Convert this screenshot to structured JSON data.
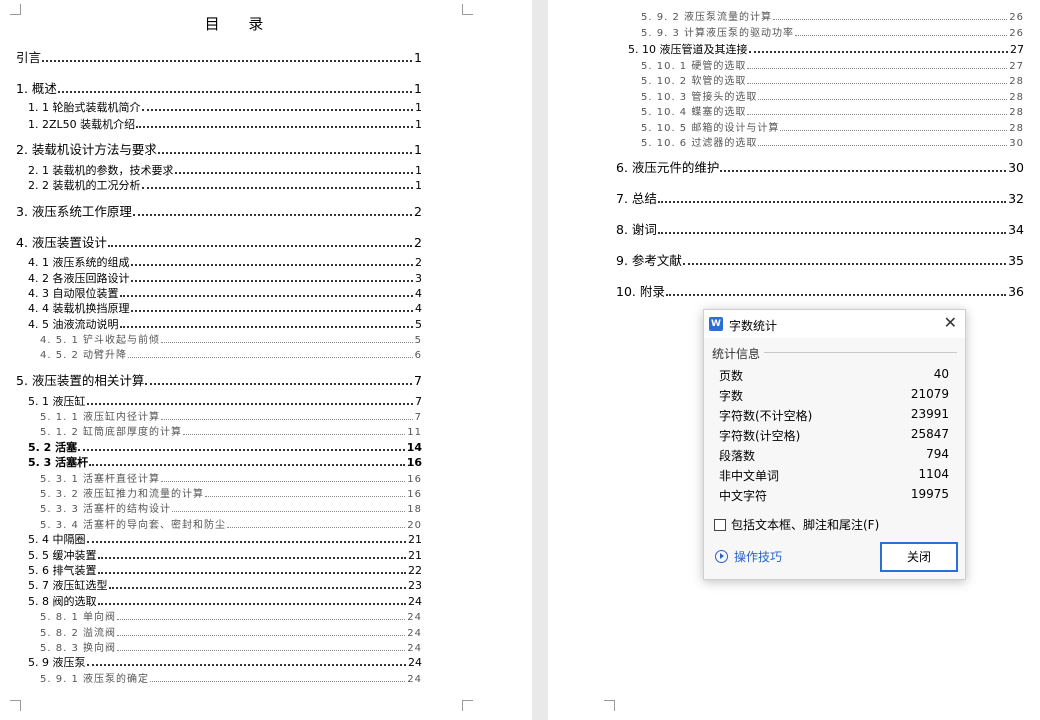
{
  "left_page": {
    "title": "目  录",
    "entries": [
      {
        "text": "引言",
        "page": "1"
      },
      {
        "text": "1. 概述",
        "page": "1"
      },
      {
        "text": "1. 1 轮胎式装载机简介",
        "page": "1"
      },
      {
        "text": "1. 2ZL50 装载机介绍",
        "page": "1"
      },
      {
        "text": "2. 装载机设计方法与要求",
        "page": "1"
      },
      {
        "text": "2. 1 装载机的参数，技术要求",
        "page": "1"
      },
      {
        "text": "2. 2 装载机的工况分析",
        "page": "1"
      },
      {
        "text": "3. 液压系统工作原理",
        "page": "2"
      },
      {
        "text": "4. 液压装置设计",
        "page": "2"
      },
      {
        "text": "4. 1 液压系统的组成",
        "page": "2"
      },
      {
        "text": "4. 2 各液压回路设计",
        "page": "3"
      },
      {
        "text": "4. 3 自动限位装置",
        "page": "4"
      },
      {
        "text": "4. 4 装载机换挡原理",
        "page": "4"
      },
      {
        "text": "4. 5 油液流动说明",
        "page": "5"
      },
      {
        "text": "4. 5. 1 铲斗收起与前倾",
        "page": "5"
      },
      {
        "text": "4. 5. 2 动臂升降",
        "page": "6"
      },
      {
        "text": "5. 液压装置的相关计算",
        "page": "7"
      },
      {
        "text": "5. 1 液压缸",
        "page": "7"
      },
      {
        "text": "5. 1. 1 液压缸内径计算",
        "page": "7"
      },
      {
        "text": "5. 1. 2 缸筒底部厚度的计算",
        "page": "11"
      },
      {
        "text": "5. 2 活塞",
        "page": "14"
      },
      {
        "text": "5. 3 活塞杆",
        "page": "16"
      },
      {
        "text": "5. 3. 1 活塞杆直径计算",
        "page": "16"
      },
      {
        "text": "5. 3. 2 液压缸推力和流量的计算",
        "page": "16"
      },
      {
        "text": "5. 3. 3 活塞杆的结构设计",
        "page": "18"
      },
      {
        "text": "5. 3. 4 活塞杆的导向套、密封和防尘",
        "page": "20"
      },
      {
        "text": "5. 4 中隔圈",
        "page": "21"
      },
      {
        "text": "5. 5 缓冲装置",
        "page": "21"
      },
      {
        "text": "5. 6 排气装置",
        "page": "22"
      },
      {
        "text": "5. 7 液压缸选型",
        "page": "23"
      },
      {
        "text": "5. 8 阀的选取",
        "page": "24"
      },
      {
        "text": "5. 8. 1 单向阀",
        "page": "24"
      },
      {
        "text": "5. 8. 2 溢流阀",
        "page": "24"
      },
      {
        "text": "5. 8. 3 换向阀",
        "page": "24"
      },
      {
        "text": "5. 9 液压泵",
        "page": "24"
      },
      {
        "text": "5. 9. 1 液压泵的确定",
        "page": "24"
      }
    ]
  },
  "right_page": {
    "entries": [
      {
        "text": "5. 9. 2 液压泵流量的计算",
        "page": "26"
      },
      {
        "text": "5. 9. 3 计算液压泵的驱动功率",
        "page": "26"
      },
      {
        "text": "5. 10 液压管道及其连接",
        "page": "27"
      },
      {
        "text": "5. 10. 1 硬管的选取",
        "page": "27"
      },
      {
        "text": "5. 10. 2 软管的选取",
        "page": "28"
      },
      {
        "text": "5. 10. 3 管接头的选取",
        "page": "28"
      },
      {
        "text": "5. 10. 4 蝶塞的选取",
        "page": "28"
      },
      {
        "text": "5. 10. 5 邮箱的设计与计算",
        "page": "28"
      },
      {
        "text": "5. 10. 6 过滤器的选取",
        "page": "30"
      },
      {
        "text": "6. 液压元件的维护",
        "page": "30"
      },
      {
        "text": "7. 总结",
        "page": "32"
      },
      {
        "text": "8. 谢词",
        "page": "34"
      },
      {
        "text": "9. 参考文献",
        "page": "35"
      },
      {
        "text": "10. 附录",
        "page": "36"
      }
    ]
  },
  "dialog": {
    "app_icon": "W",
    "title": "字数统计",
    "section_label": "统计信息",
    "stats": [
      {
        "label": "页数",
        "value": "40"
      },
      {
        "label": "字数",
        "value": "21079"
      },
      {
        "label": "字符数(不计空格)",
        "value": "23991"
      },
      {
        "label": "字符数(计空格)",
        "value": "25847"
      },
      {
        "label": "段落数",
        "value": "794"
      },
      {
        "label": "非中文单词",
        "value": "1104"
      },
      {
        "label": "中文字符",
        "value": "19975"
      }
    ],
    "include_checkbox_label": "包括文本框、脚注和尾注(F)",
    "tips_link": "操作技巧",
    "close_button": "关闭",
    "close_glyph": "✕"
  },
  "colors": {
    "accent": "#2b6fd6",
    "link": "#2a62c9",
    "workspace": "#e9e9e9"
  }
}
